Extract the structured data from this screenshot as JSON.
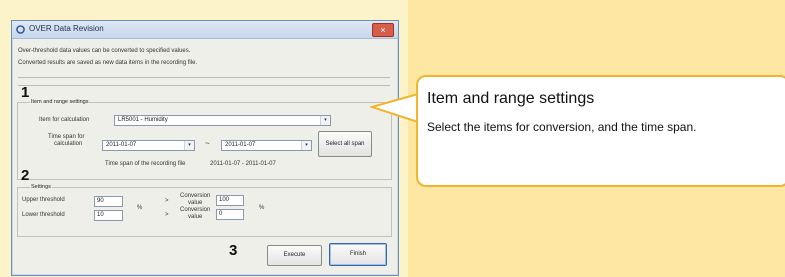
{
  "window": {
    "title": "OVER Data Revision",
    "close_label": "×",
    "desc1": "Over-threshold data values can be converted to specified values.",
    "desc2": "Converted results are saved as new data items in the recording file."
  },
  "item_range": {
    "group_label": "Item and range settings",
    "item_label": "Item for calculation",
    "item_value": "LR5001 - Humidity",
    "timespan_label_1": "Time span for",
    "timespan_label_2": "calculation",
    "start_date": "2011-01-07",
    "tilde": "~",
    "end_date": "2011-01-07",
    "select_all_label": "Select all span",
    "recording_span_label": "Time span of the recording file",
    "recording_span_value": "2011-01-07 - 2011-01-07"
  },
  "settings": {
    "group_label": "Settings",
    "upper_label": "Upper threshold",
    "upper_value": "90",
    "lower_label": "Lower threshold",
    "lower_value": "10",
    "pct": "%",
    "arrow": ">",
    "conv_label_1": "Conversion",
    "conv_label_2": "value",
    "conv_upper_value": "100",
    "conv_lower_value": "0"
  },
  "buttons": {
    "execute_label": "Execute",
    "finish_label": "Finish"
  },
  "badges": {
    "one": "1",
    "two": "2",
    "three": "3"
  },
  "callout": {
    "title": "Item and range settings",
    "body": "Select the items for conversion, and the time span."
  },
  "colors": {
    "background": "#fde7a2",
    "callout_border": "#f1b52b",
    "close_button": "#d75e4b"
  }
}
